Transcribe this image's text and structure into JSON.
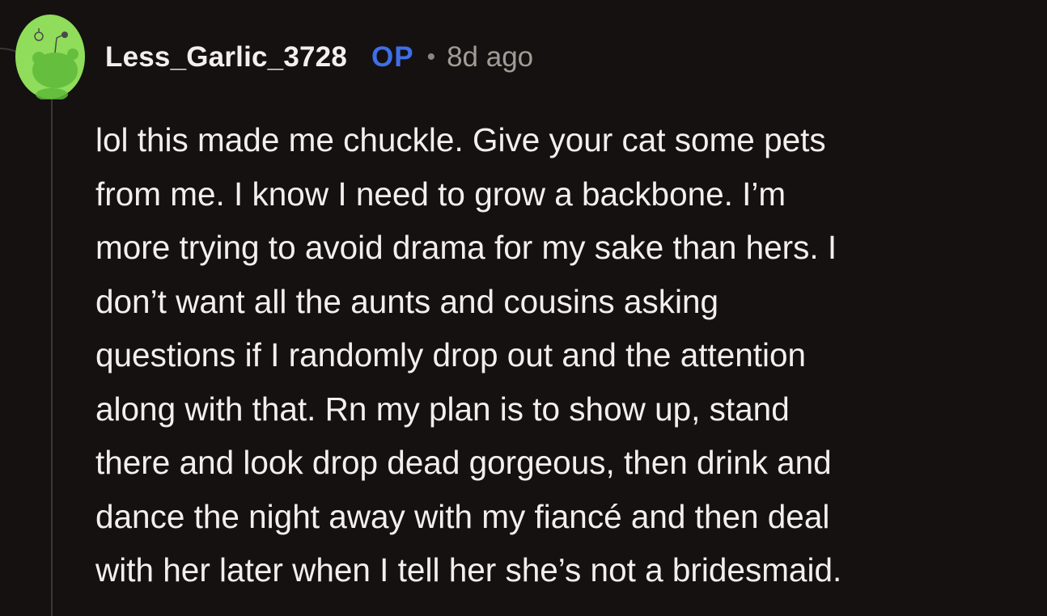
{
  "comment": {
    "username": "Less_Garlic_3728",
    "op_badge": "OP",
    "separator": "•",
    "timestamp": "8d ago",
    "avatar_icon": "snoo-avatar-icon",
    "lines": [
      "lol this made me chuckle. Give your cat some pets",
      "from me. I know I need to grow a backbone. I’m",
      "more trying to avoid drama for my sake than hers. I",
      "don’t want all the aunts and cousins asking",
      "questions if I randomly drop out and the attention",
      "along with that. Rn my plan is to show up, stand",
      "there and look drop dead gorgeous, then drink and",
      "dance the night away with my fiancé and then deal",
      "with her later when I tell her she’s not a bridesmaid."
    ]
  },
  "colors": {
    "background": "#141110",
    "text": "#f2efec",
    "op": "#3f6ee8",
    "meta": "#a29b96",
    "avatar": "#8fdd5a"
  }
}
